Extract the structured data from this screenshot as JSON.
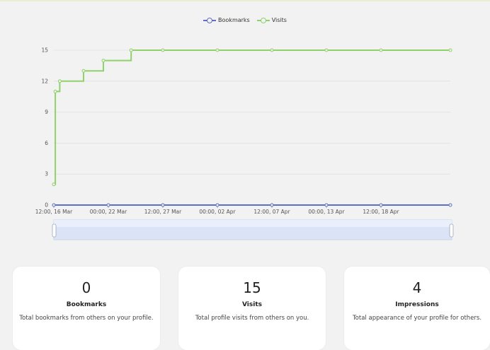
{
  "legend": [
    {
      "name": "Bookmarks",
      "color": "#5b6fc6"
    },
    {
      "name": "Visits",
      "color": "#8fd16a"
    }
  ],
  "chart_data": {
    "type": "line",
    "y_ticks": [
      0,
      3,
      6,
      9,
      12,
      15
    ],
    "ylim": [
      0,
      15
    ],
    "x_ticks": [
      "12:00, 16 Mar",
      "00:00, 22 Mar",
      "12:00, 27 Mar",
      "00:00, 02 Apr",
      "12:00, 07 Apr",
      "00:00, 13 Apr",
      "12:00, 18 Apr"
    ],
    "x_tick_days": [
      0,
      5.5,
      11,
      16.5,
      22,
      27.5,
      33
    ],
    "xlim_days": [
      0,
      40
    ],
    "x_unit": "days from 12:00, 16 Mar",
    "grid": "horizontal",
    "series": [
      {
        "name": "Bookmarks",
        "color": "#5b6fc6",
        "step": false,
        "points": [
          [
            0,
            0
          ],
          [
            5.5,
            0
          ],
          [
            11,
            0
          ],
          [
            16.5,
            0
          ],
          [
            22,
            0
          ],
          [
            27.5,
            0
          ],
          [
            33,
            0
          ],
          [
            40,
            0
          ]
        ]
      },
      {
        "name": "Visits",
        "color": "#8fd16a",
        "step": true,
        "points": [
          [
            0,
            2
          ],
          [
            0.15,
            11
          ],
          [
            0.6,
            12
          ],
          [
            3.0,
            13
          ],
          [
            5.0,
            14
          ],
          [
            7.8,
            15
          ],
          [
            11,
            15
          ],
          [
            16.5,
            15
          ],
          [
            22,
            15
          ],
          [
            27.5,
            15
          ],
          [
            33,
            15
          ],
          [
            40,
            15
          ]
        ]
      }
    ]
  },
  "stats": [
    {
      "value": "0",
      "label": "Bookmarks",
      "description": "Total bookmarks from others on your profile."
    },
    {
      "value": "15",
      "label": "Visits",
      "description": "Total profile visits from others on you."
    },
    {
      "value": "4",
      "label": "Impressions",
      "description": "Total appearance of your profile for others."
    }
  ]
}
